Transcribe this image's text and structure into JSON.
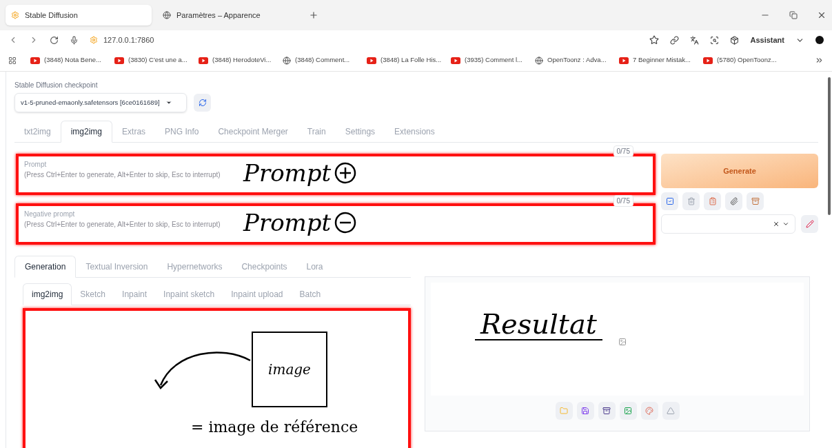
{
  "browser": {
    "tabs": [
      {
        "title": "Stable Diffusion",
        "selected": true
      },
      {
        "title": "Paramètres – Apparence",
        "selected": false
      }
    ],
    "url": "127.0.0.1:7860",
    "assistant": "Assistant",
    "bookmarks": [
      {
        "kind": "video",
        "label": "(3848) Nota Bene..."
      },
      {
        "kind": "video",
        "label": "(3830) C'est une a..."
      },
      {
        "kind": "video",
        "label": "(3848) HerodoteVi..."
      },
      {
        "kind": "web",
        "label": "(3848) Comment..."
      },
      {
        "kind": "video",
        "label": "(3848) La Folle His..."
      },
      {
        "kind": "video",
        "label": "(3935) Comment l..."
      },
      {
        "kind": "web",
        "label": "OpenToonz : Adva..."
      },
      {
        "kind": "video",
        "label": "7 Beginner Mistak..."
      },
      {
        "kind": "video",
        "label": "(5780) OpenToonz..."
      }
    ]
  },
  "checkpoint": {
    "label": "Stable Diffusion checkpoint",
    "value": "v1-5-pruned-emaonly.safetensors [6ce0161689]"
  },
  "tabs": [
    {
      "label": "txt2img",
      "selected": false
    },
    {
      "label": "img2img",
      "selected": true
    },
    {
      "label": "Extras",
      "selected": false
    },
    {
      "label": "PNG Info",
      "selected": false
    },
    {
      "label": "Checkpoint Merger",
      "selected": false
    },
    {
      "label": "Train",
      "selected": false
    },
    {
      "label": "Settings",
      "selected": false
    },
    {
      "label": "Extensions",
      "selected": false
    }
  ],
  "prompt": {
    "label": "Prompt",
    "placeholder": "(Press Ctrl+Enter to generate, Alt+Enter to skip, Esc to interrupt)",
    "counter": "0/75"
  },
  "negative_prompt": {
    "label": "Negative prompt",
    "placeholder": "(Press Ctrl+Enter to generate, Alt+Enter to skip, Esc to interrupt)",
    "counter": "0/75"
  },
  "generate": "Generate",
  "generation_tabs": [
    {
      "label": "Generation",
      "selected": true
    },
    {
      "label": "Textual Inversion",
      "selected": false
    },
    {
      "label": "Hypernetworks",
      "selected": false
    },
    {
      "label": "Checkpoints",
      "selected": false
    },
    {
      "label": "Lora",
      "selected": false
    }
  ],
  "image_tabs": [
    {
      "label": "img2img",
      "selected": true
    },
    {
      "label": "Sketch",
      "selected": false
    },
    {
      "label": "Inpaint",
      "selected": false
    },
    {
      "label": "Inpaint sketch",
      "selected": false
    },
    {
      "label": "Inpaint upload",
      "selected": false
    },
    {
      "label": "Batch",
      "selected": false
    }
  ],
  "annotations": {
    "prompt_positive": "Prompt",
    "prompt_negative": "Prompt",
    "sketch": "image",
    "reference": "= image de référence",
    "result": "Resultat"
  }
}
